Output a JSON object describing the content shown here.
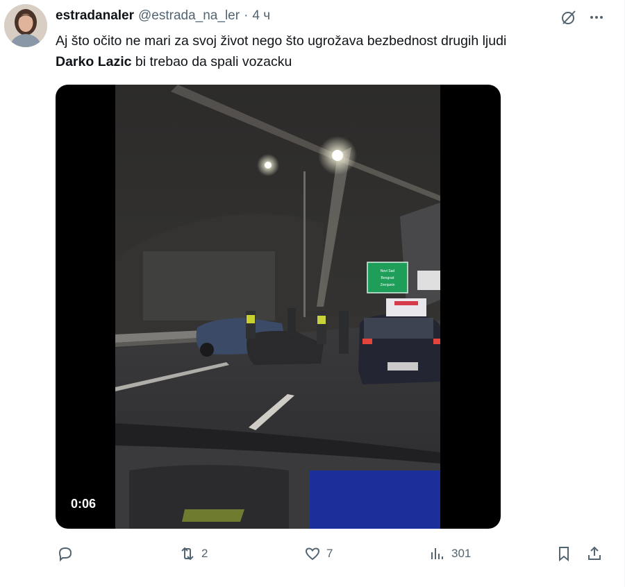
{
  "tweet": {
    "author": {
      "display_name": "estradanaler",
      "handle": "@estrada_na_ler",
      "separator": "·",
      "time": "4 ч"
    },
    "text": {
      "line1": "Aj što očito ne mari za svoj život nego što ugrožava bezbednost drugih ljudi",
      "mention_bold": "Darko Lazic",
      "line2_rest": " bi trebao da spali vozacku"
    },
    "media": {
      "duration": "0:06",
      "sign_text": [
        "Novi Sad",
        "Beograd",
        "Zrenjanin"
      ]
    },
    "stats": {
      "retweets": "2",
      "likes": "7",
      "views": "301"
    },
    "icons": [
      "grok-icon",
      "more-icon",
      "reply-icon",
      "retweet-icon",
      "like-icon",
      "views-icon",
      "bookmark-icon",
      "share-icon"
    ]
  }
}
